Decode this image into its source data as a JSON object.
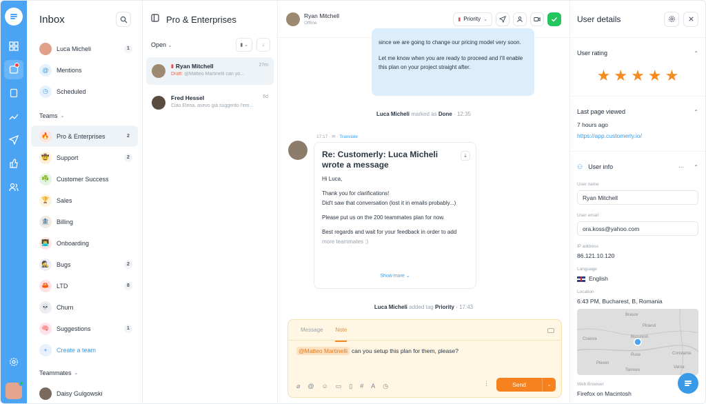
{
  "inbox": {
    "title": "Inbox",
    "items": [
      {
        "label": "Luca Micheli",
        "count": "1"
      },
      {
        "label": "Mentions",
        "count": ""
      },
      {
        "label": "Scheduled",
        "count": ""
      }
    ],
    "teams_label": "Teams",
    "teams": [
      {
        "label": "Pro & Enterprises",
        "count": "2",
        "emoji": "🔥",
        "bg": "#fde7e2"
      },
      {
        "label": "Support",
        "count": "2",
        "emoji": "🤠",
        "bg": "#fdf0d9"
      },
      {
        "label": "Customer Success",
        "count": "",
        "emoji": "☘️",
        "bg": "#e4f5e4"
      },
      {
        "label": "Sales",
        "count": "",
        "emoji": "🏆",
        "bg": "#fdf3dc"
      },
      {
        "label": "Billing",
        "count": "",
        "emoji": "🏦",
        "bg": "#f1ece3"
      },
      {
        "label": "Onboarding",
        "count": "",
        "emoji": "👨‍💻",
        "bg": "#fde7e2"
      },
      {
        "label": "Bugs",
        "count": "2",
        "emoji": "🕵️",
        "bg": "#eceef4"
      },
      {
        "label": "LTD",
        "count": "8",
        "emoji": "🦀",
        "bg": "#fde3e3"
      },
      {
        "label": "Churn",
        "count": "",
        "emoji": "💀",
        "bg": "#eceef2"
      },
      {
        "label": "Suggestions",
        "count": "1",
        "emoji": "🧠",
        "bg": "#fde3ea"
      }
    ],
    "create_team": "Create a team",
    "teammates_label": "Teammates",
    "teammates": [
      {
        "label": "Daisy Gulgowski"
      }
    ]
  },
  "conversations": {
    "title": "Pro & Enterprises",
    "filter": "Open",
    "items": [
      {
        "name": "Ryan Mitchell",
        "draft": "Draft:",
        "preview": "@Matteo Martinelli can yo...",
        "time": "27m"
      },
      {
        "name": "Fred Hessel",
        "draft": "",
        "preview": "Ciao Elena, avevo già suggerito l'em...",
        "time": "6d"
      }
    ]
  },
  "chat": {
    "user_name": "Ryan Mitchell",
    "user_status": "Offline",
    "priority_label": "Priority",
    "outgoing": {
      "p1": "since we are going to change our pricing model very soon.",
      "p2": "Let me know when you are ready to proceed and I'll enable this plan on your project straight after."
    },
    "event1": {
      "who": "Luca Micheli",
      "action": "marked as",
      "what": "Done",
      "time": "· 12:35"
    },
    "message_meta": {
      "time": "17:17",
      "translate": "Translate"
    },
    "message": {
      "subject": "Re: Customerly: Luca Micheli wrote a message",
      "greeting": "Hi Luca,",
      "line1": "Thank you for clarifications!",
      "line2": "Did't saw that conversation (lost it in emails probably...)",
      "line3": "Please put us on the 200 teammates plan for now.",
      "line4": "Best regards and wait for your feedback in order to add",
      "line5": "more teammates :)",
      "show_more": "Show more"
    },
    "event2": {
      "who": "Luca Micheli",
      "action": "added tag",
      "what": "Priority",
      "time": "· 17:43"
    },
    "composer": {
      "tab_message": "Message",
      "tab_note": "Note",
      "mention": "@Matteo Martinelli",
      "text": "can you setup this plan for them, please?",
      "send_label": "Send"
    }
  },
  "details": {
    "title": "User details",
    "rating_title": "User rating",
    "rating": 5,
    "last_page_title": "Last page viewed",
    "last_page_time": "7 hours ago",
    "last_page_url": "https://app.customerly.io/",
    "user_info_title": "User info",
    "name_label": "User name",
    "name_value": "Ryan Mitchell",
    "email_label": "User email",
    "email_value": "ora.koss@yahoo.com",
    "ip_label": "IP address",
    "ip_value": "86.121.10.120",
    "language_label": "Language",
    "language_value": "English",
    "location_label": "Location",
    "location_value": "6:43 PM, Bucharest, B, Romania",
    "map_labels": [
      "Brasov",
      "Ploiesti",
      "Craiova",
      "Bucuresti",
      "Ruse",
      "Constanta",
      "Pleven",
      "Tarnovo",
      "Varna"
    ],
    "browser_label": "Web Browser",
    "browser_value": "Firefox on Macintosh"
  },
  "colors": {
    "rail": "#4aa3f3",
    "accent": "#f5821f",
    "done": "#22c55e",
    "link": "#3a9ae8"
  }
}
